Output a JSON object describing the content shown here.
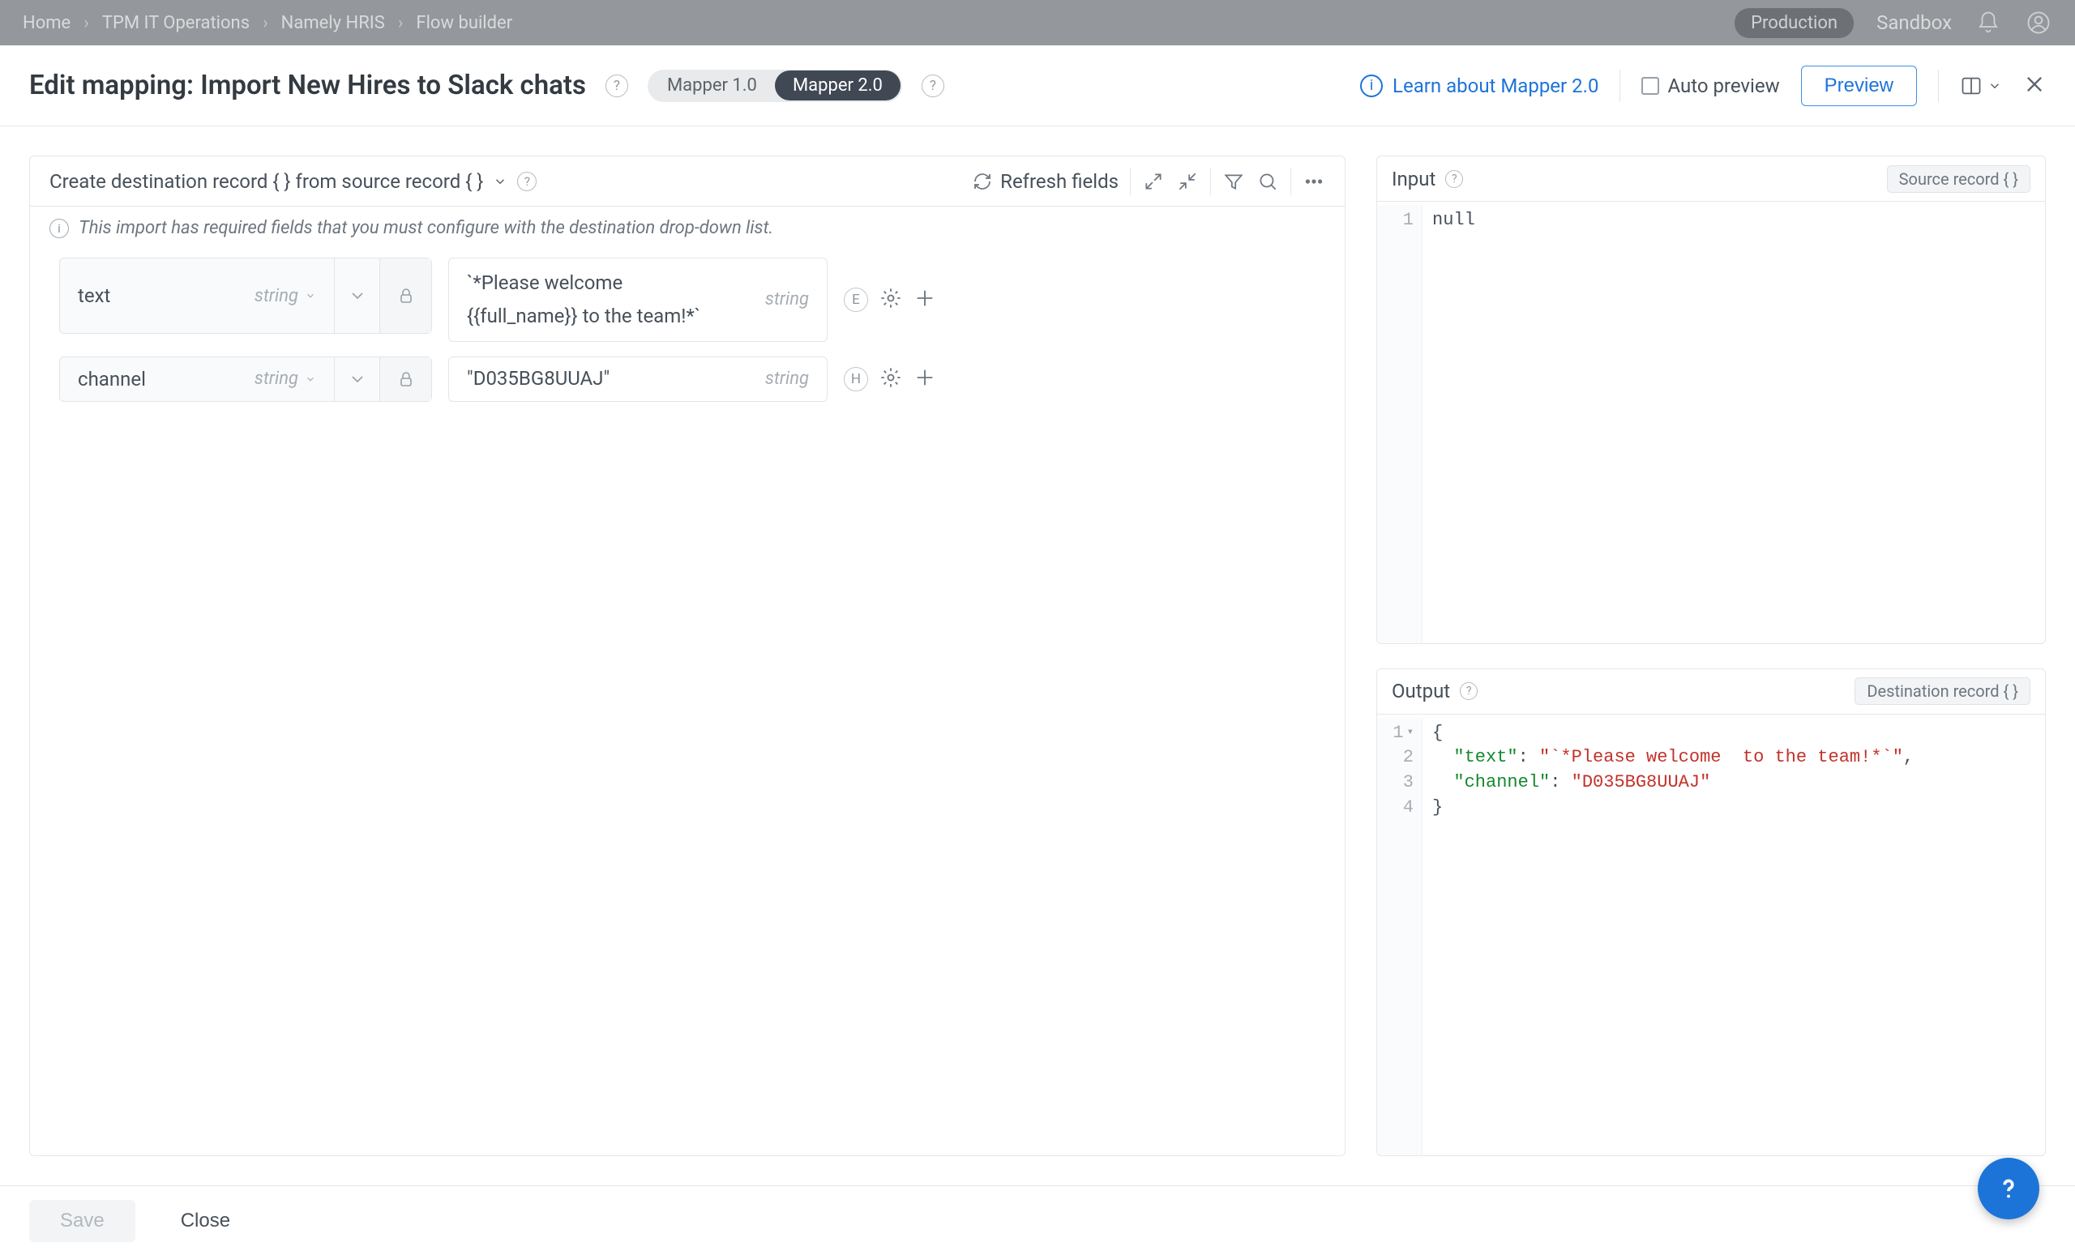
{
  "topbar": {
    "breadcrumbs": [
      "Home",
      "TPM IT Operations",
      "Namely HRIS",
      "Flow builder"
    ],
    "production_label": "Production",
    "sandbox_label": "Sandbox"
  },
  "header": {
    "title_prefix": "Edit mapping: ",
    "title_name": "Import New Hires to Slack chats",
    "mapper_options": [
      "Mapper 1.0",
      "Mapper 2.0"
    ],
    "mapper_active_index": 1,
    "learn_link": "Learn about Mapper 2.0",
    "auto_preview_label": "Auto preview",
    "preview_button": "Preview"
  },
  "left_panel": {
    "head_title": "Create destination record { } from source record { }",
    "refresh_label": "Refresh fields",
    "info_text": "This import has required fields that you must configure with the destination drop-down list.",
    "rows": [
      {
        "dest_name": "text",
        "dest_type": "string",
        "src_value": "`*Please welcome\n{{full_name}} to the team!*`",
        "src_type": "string",
        "badge": "E"
      },
      {
        "dest_name": "channel",
        "dest_type": "string",
        "src_value": "\"D035BG8UUAJ\"",
        "src_type": "string",
        "badge": "H"
      }
    ]
  },
  "right_panel": {
    "input": {
      "title": "Input",
      "tag": "Source record { }",
      "lines": [
        "null"
      ]
    },
    "output": {
      "title": "Output",
      "tag": "Destination record { }",
      "json": {
        "text": "`*Please welcome  to the team!*`",
        "channel": "D035BG8UUAJ"
      }
    }
  },
  "footer": {
    "save": "Save",
    "close": "Close"
  }
}
